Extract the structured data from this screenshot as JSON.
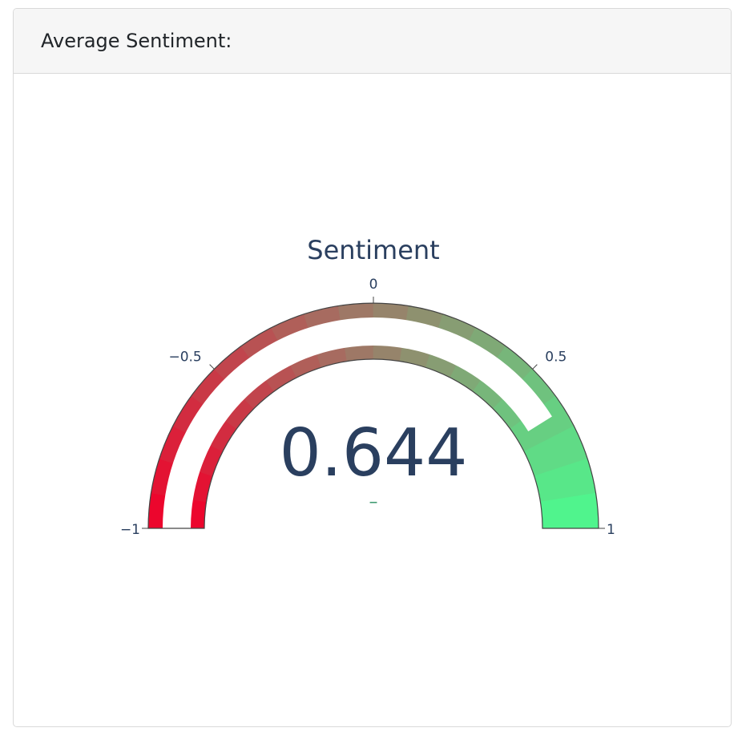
{
  "card": {
    "title": "Average Sentiment:"
  },
  "chart_data": {
    "type": "gauge",
    "title": "Sentiment",
    "value": 0.644,
    "value_label": "0.644",
    "delta_label": "–",
    "range": [
      -1,
      1
    ],
    "ticks": [
      {
        "value": -1,
        "label": "−1"
      },
      {
        "value": -0.5,
        "label": "−0.5"
      },
      {
        "value": 0,
        "label": "0"
      },
      {
        "value": 0.5,
        "label": "0.5"
      },
      {
        "value": 1,
        "label": "1"
      }
    ],
    "steps": 20,
    "colors": {
      "negative": "#f0002a",
      "positive": "#4cfa8f",
      "mid": "#9a7e69",
      "text": "#2a3f5f",
      "delta": "#3d9970",
      "outline": "#444444"
    }
  }
}
